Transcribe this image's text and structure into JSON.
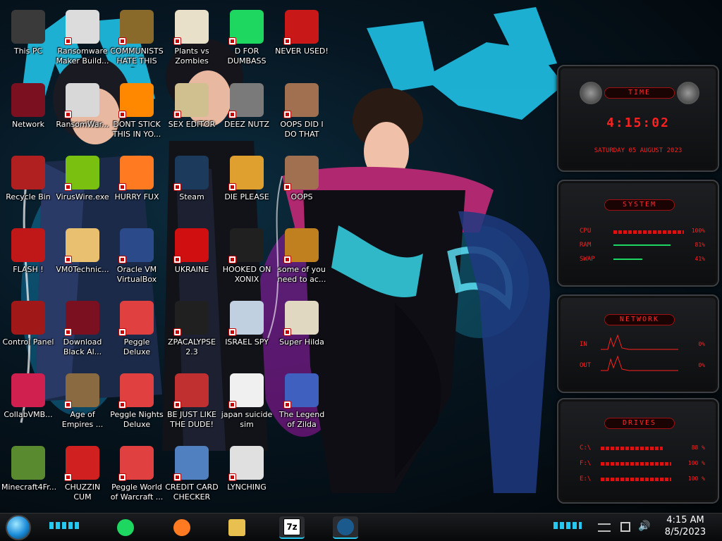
{
  "desktop": {
    "icons": [
      {
        "label": "This PC",
        "icon": "computer-icon",
        "color": "#3a3a3a"
      },
      {
        "label": "Ransomware Maker Build...",
        "icon": "window-app-icon",
        "color": "#dcdcdc"
      },
      {
        "label": "COMMUNISTS HATE THIS G...",
        "icon": "money-bag-icon",
        "color": "#8a6a2a"
      },
      {
        "label": "Plants vs Zombies",
        "icon": "plant-icon",
        "color": "#e8e0c8"
      },
      {
        "label": "D FOR DUMBASS",
        "icon": "spotify-like-icon",
        "color": "#1ed760"
      },
      {
        "label": "NEVER USED!",
        "icon": "dev-cpp-icon",
        "color": "#c81818"
      },
      {
        "label": "Network",
        "icon": "network-orb-icon",
        "color": "#7a1020"
      },
      {
        "label": "RansomWar...",
        "icon": "skull-icon",
        "color": "#d8d8d8"
      },
      {
        "label": "DONT STICK THIS IN YO...",
        "icon": "vlc-cone-icon",
        "color": "#ff8800"
      },
      {
        "label": "SEX EDITOR",
        "icon": "hxd-icon",
        "color": "#d0c090"
      },
      {
        "label": "DEEZ NUTZ",
        "icon": "stacked-pages-icon",
        "color": "#7a7a7a"
      },
      {
        "label": "OOPS DID I DO THAT",
        "icon": "portrait-icon",
        "color": "#a07050"
      },
      {
        "label": "Recycle Bin",
        "icon": "recycle-bin-icon",
        "color": "#b02020"
      },
      {
        "label": "VirusWire.exe",
        "icon": "lime-icon",
        "color": "#7ac010"
      },
      {
        "label": "HURRY FUX",
        "icon": "firefox-icon",
        "color": "#ff7a20"
      },
      {
        "label": "Steam",
        "icon": "steam-icon",
        "color": "#1b3a5c"
      },
      {
        "label": "DIE PLEASE",
        "icon": "de-box-icon",
        "color": "#e0a030"
      },
      {
        "label": "OOPS",
        "icon": "portrait-icon",
        "color": "#a07050"
      },
      {
        "label": "FLASH !",
        "icon": "flash-icon",
        "color": "#c01818"
      },
      {
        "label": "VM0Technic...",
        "icon": "doctor-icon",
        "color": "#e8c070"
      },
      {
        "label": "Oracle VM VirtualBox",
        "icon": "virtualbox-icon",
        "color": "#2a4a8a"
      },
      {
        "label": "UKRAINE",
        "icon": "radiation-icon",
        "color": "#d01010"
      },
      {
        "label": "HOOKED ON XONIX",
        "icon": "xonix-icon",
        "color": "#202020"
      },
      {
        "label": "some of you need to ac...",
        "icon": "dog-icon",
        "color": "#c08020"
      },
      {
        "label": "Control Panel",
        "icon": "control-panel-icon",
        "color": "#a01818"
      },
      {
        "label": "Download Black Al...",
        "icon": "network-orb-icon",
        "color": "#7a1020"
      },
      {
        "label": "Peggle Deluxe",
        "icon": "peggle-icon",
        "color": "#e04040"
      },
      {
        "label": "ZPACALYPSE 2.3",
        "icon": "terminal-icon",
        "color": "#202020"
      },
      {
        "label": "ISRAEL SPY",
        "icon": "spy-icon",
        "color": "#c0d0e0"
      },
      {
        "label": "Super Hilda",
        "icon": "pixel-dog-icon",
        "color": "#e0d8c0"
      },
      {
        "label": "CollabVMB...",
        "icon": "monitor-icon",
        "color": "#d02050"
      },
      {
        "label": "Age of Empires ...",
        "icon": "samurai-icon",
        "color": "#8a6a40"
      },
      {
        "label": "Peggle Nights Deluxe",
        "icon": "peggle-icon",
        "color": "#e04040"
      },
      {
        "label": "BE JUST LIKE THE DUDE!",
        "icon": "santa-icon",
        "color": "#c03030"
      },
      {
        "label": "japan suicide sim",
        "icon": "document-icon",
        "color": "#f0f0f0"
      },
      {
        "label": "The Legend of Zilda",
        "icon": "pixel-hero-icon",
        "color": "#4060c0"
      },
      {
        "label": "Minecraft4Fr...",
        "icon": "grass-block-icon",
        "color": "#5a8a30"
      },
      {
        "label": "CHUZZIN CUM",
        "icon": "chuzzle-icon",
        "color": "#d02020"
      },
      {
        "label": "Peggle World of Warcraft ...",
        "icon": "peggle-icon",
        "color": "#e04040"
      },
      {
        "label": "CREDIT CARD CHECKER",
        "icon": "credit-card-icon",
        "color": "#5080c0"
      },
      {
        "label": "LYNCHING",
        "icon": "noose-icon",
        "color": "#e0e0e0"
      }
    ]
  },
  "widgets": {
    "time": {
      "title": "TIME",
      "clock": "4:15:02",
      "date": "SATURDAY 05 AUGUST 2023"
    },
    "system": {
      "title": "SYSTEM",
      "rows": [
        {
          "label": "CPU",
          "value": "100%",
          "level": 1.0
        },
        {
          "label": "RAM",
          "value": "81%",
          "level": 0.81
        },
        {
          "label": "SWAP",
          "value": "41%",
          "level": 0.41
        }
      ]
    },
    "network": {
      "title": "NETWORK",
      "rows": [
        {
          "label": "IN",
          "value": "0%"
        },
        {
          "label": "OUT",
          "value": "0%"
        }
      ]
    },
    "drives": {
      "title": "DRIVES",
      "rows": [
        {
          "label": "C:\\",
          "value": "88 %",
          "level": 0.88
        },
        {
          "label": "F:\\",
          "value": "100 %",
          "level": 1.0
        },
        {
          "label": "E:\\",
          "value": "100 %",
          "level": 1.0
        }
      ]
    }
  },
  "taskbar": {
    "apps": [
      {
        "name": "spotify-like-icon",
        "color": "#1ed760"
      },
      {
        "name": "firefox-icon",
        "color": "#ff7a20"
      },
      {
        "name": "file-explorer-icon",
        "color": "#e8c050"
      },
      {
        "name": "7zip-icon",
        "label": "7z",
        "color": "#ffffff"
      },
      {
        "name": "steam-icon",
        "color": "#1b5a8c"
      }
    ],
    "clock_time": "4:15 AM",
    "clock_date": "8/5/2023"
  },
  "colors": {
    "accent_red": "#ff2020",
    "wallpaper_cyan": "#22c8e8",
    "wallpaper_magenta": "#e020c0"
  }
}
